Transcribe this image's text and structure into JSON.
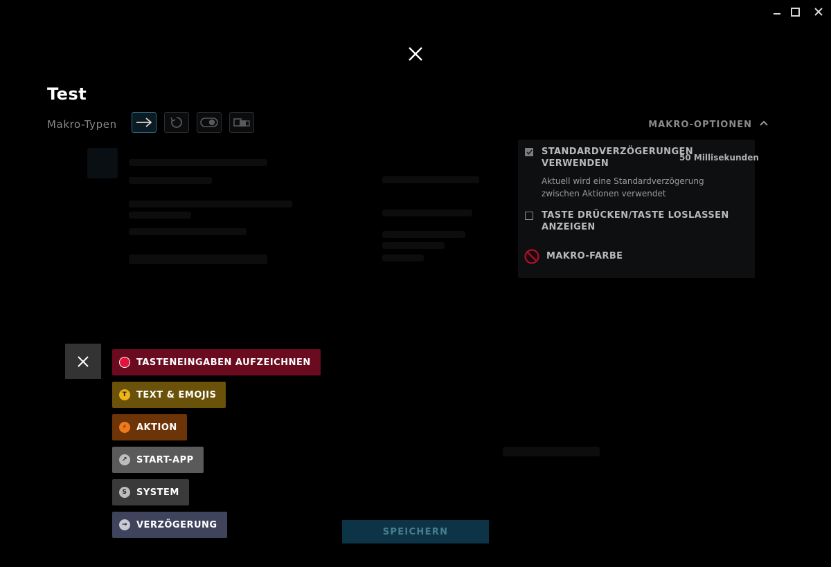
{
  "window": {
    "controls": [
      "minimize-icon",
      "maximize-icon",
      "close-icon"
    ]
  },
  "overlay": {
    "close_icon": "close-icon"
  },
  "macro": {
    "title": "Test",
    "types_label": "Makro-Typen",
    "types": [
      {
        "icon": "arrow-right-icon",
        "active": true
      },
      {
        "icon": "repeat-icon",
        "active": false
      },
      {
        "icon": "toggle-icon",
        "active": false
      },
      {
        "icon": "sequence-icon",
        "active": false
      }
    ]
  },
  "options": {
    "header": "MAKRO-OPTIONEN",
    "default_delays": {
      "label": "STANDARDVERZÖGERUNGEN VERWENDEN",
      "value": "50 Millisekunden",
      "description": "Aktuell wird eine Standardverzögerung zwischen Aktionen verwendet",
      "checked": true
    },
    "key_press_release": {
      "label": "TASTE DRÜCKEN/TASTE LOSLASSEN ANZEIGEN",
      "checked": false
    },
    "macro_color": {
      "label": "MAKRO-FARBE",
      "icon": "no-color-icon"
    }
  },
  "action_menu": {
    "close_icon": "close-icon",
    "items": [
      {
        "label": "TASTENEINGABEN AUFZEICHNEN",
        "icon": "record-icon",
        "bg": "#6b0b1f",
        "icon_bg": "#e0143c",
        "glyph": ""
      },
      {
        "label": "TEXT & EMOJIS",
        "icon": "text-icon",
        "bg": "#6b520a",
        "icon_bg": "#f0b418",
        "glyph": "T"
      },
      {
        "label": "AKTION",
        "icon": "lightning-icon",
        "bg": "#6d3408",
        "icon_bg": "#f07a1a",
        "glyph": "⚡"
      },
      {
        "label": "START-APP",
        "icon": "launch-app-icon",
        "bg": "#5a5a5a",
        "icon_bg": "#bdbdbd",
        "glyph": "↗"
      },
      {
        "label": "SYSTEM",
        "icon": "system-icon",
        "bg": "#3a3a3a",
        "icon_bg": "#bdbdbd",
        "glyph": "S"
      },
      {
        "label": "VERZÖGERUNG",
        "icon": "delay-icon",
        "bg": "#3f435c",
        "icon_bg": "#c9cbd3",
        "glyph": "→"
      }
    ]
  },
  "footer": {
    "save_label": "SPEICHERN"
  }
}
